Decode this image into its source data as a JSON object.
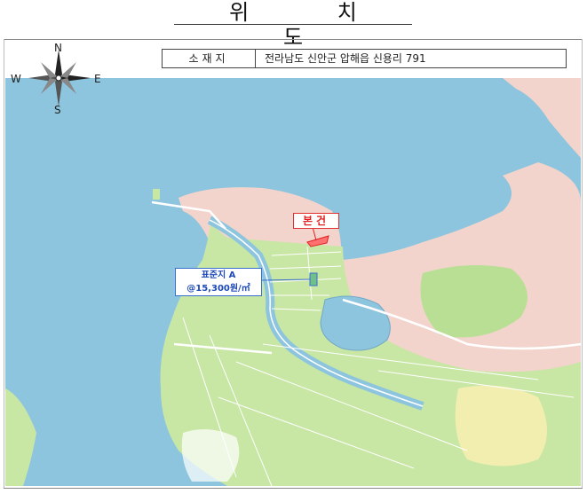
{
  "title": "위 치 도",
  "location": {
    "label": "소재지",
    "address": "전라남도 신안군 압해읍 신용리 791"
  },
  "compass": {
    "n": "N",
    "s": "S",
    "e": "E",
    "w": "W"
  },
  "markers": {
    "subject": "본건",
    "standard_name": "표준지 A",
    "standard_price": "@15,300원/㎡"
  },
  "colors": {
    "sea": "#8ec5de",
    "land": "#c8e6a4",
    "hill": "#f3d4cc",
    "road": "#ffffff"
  }
}
